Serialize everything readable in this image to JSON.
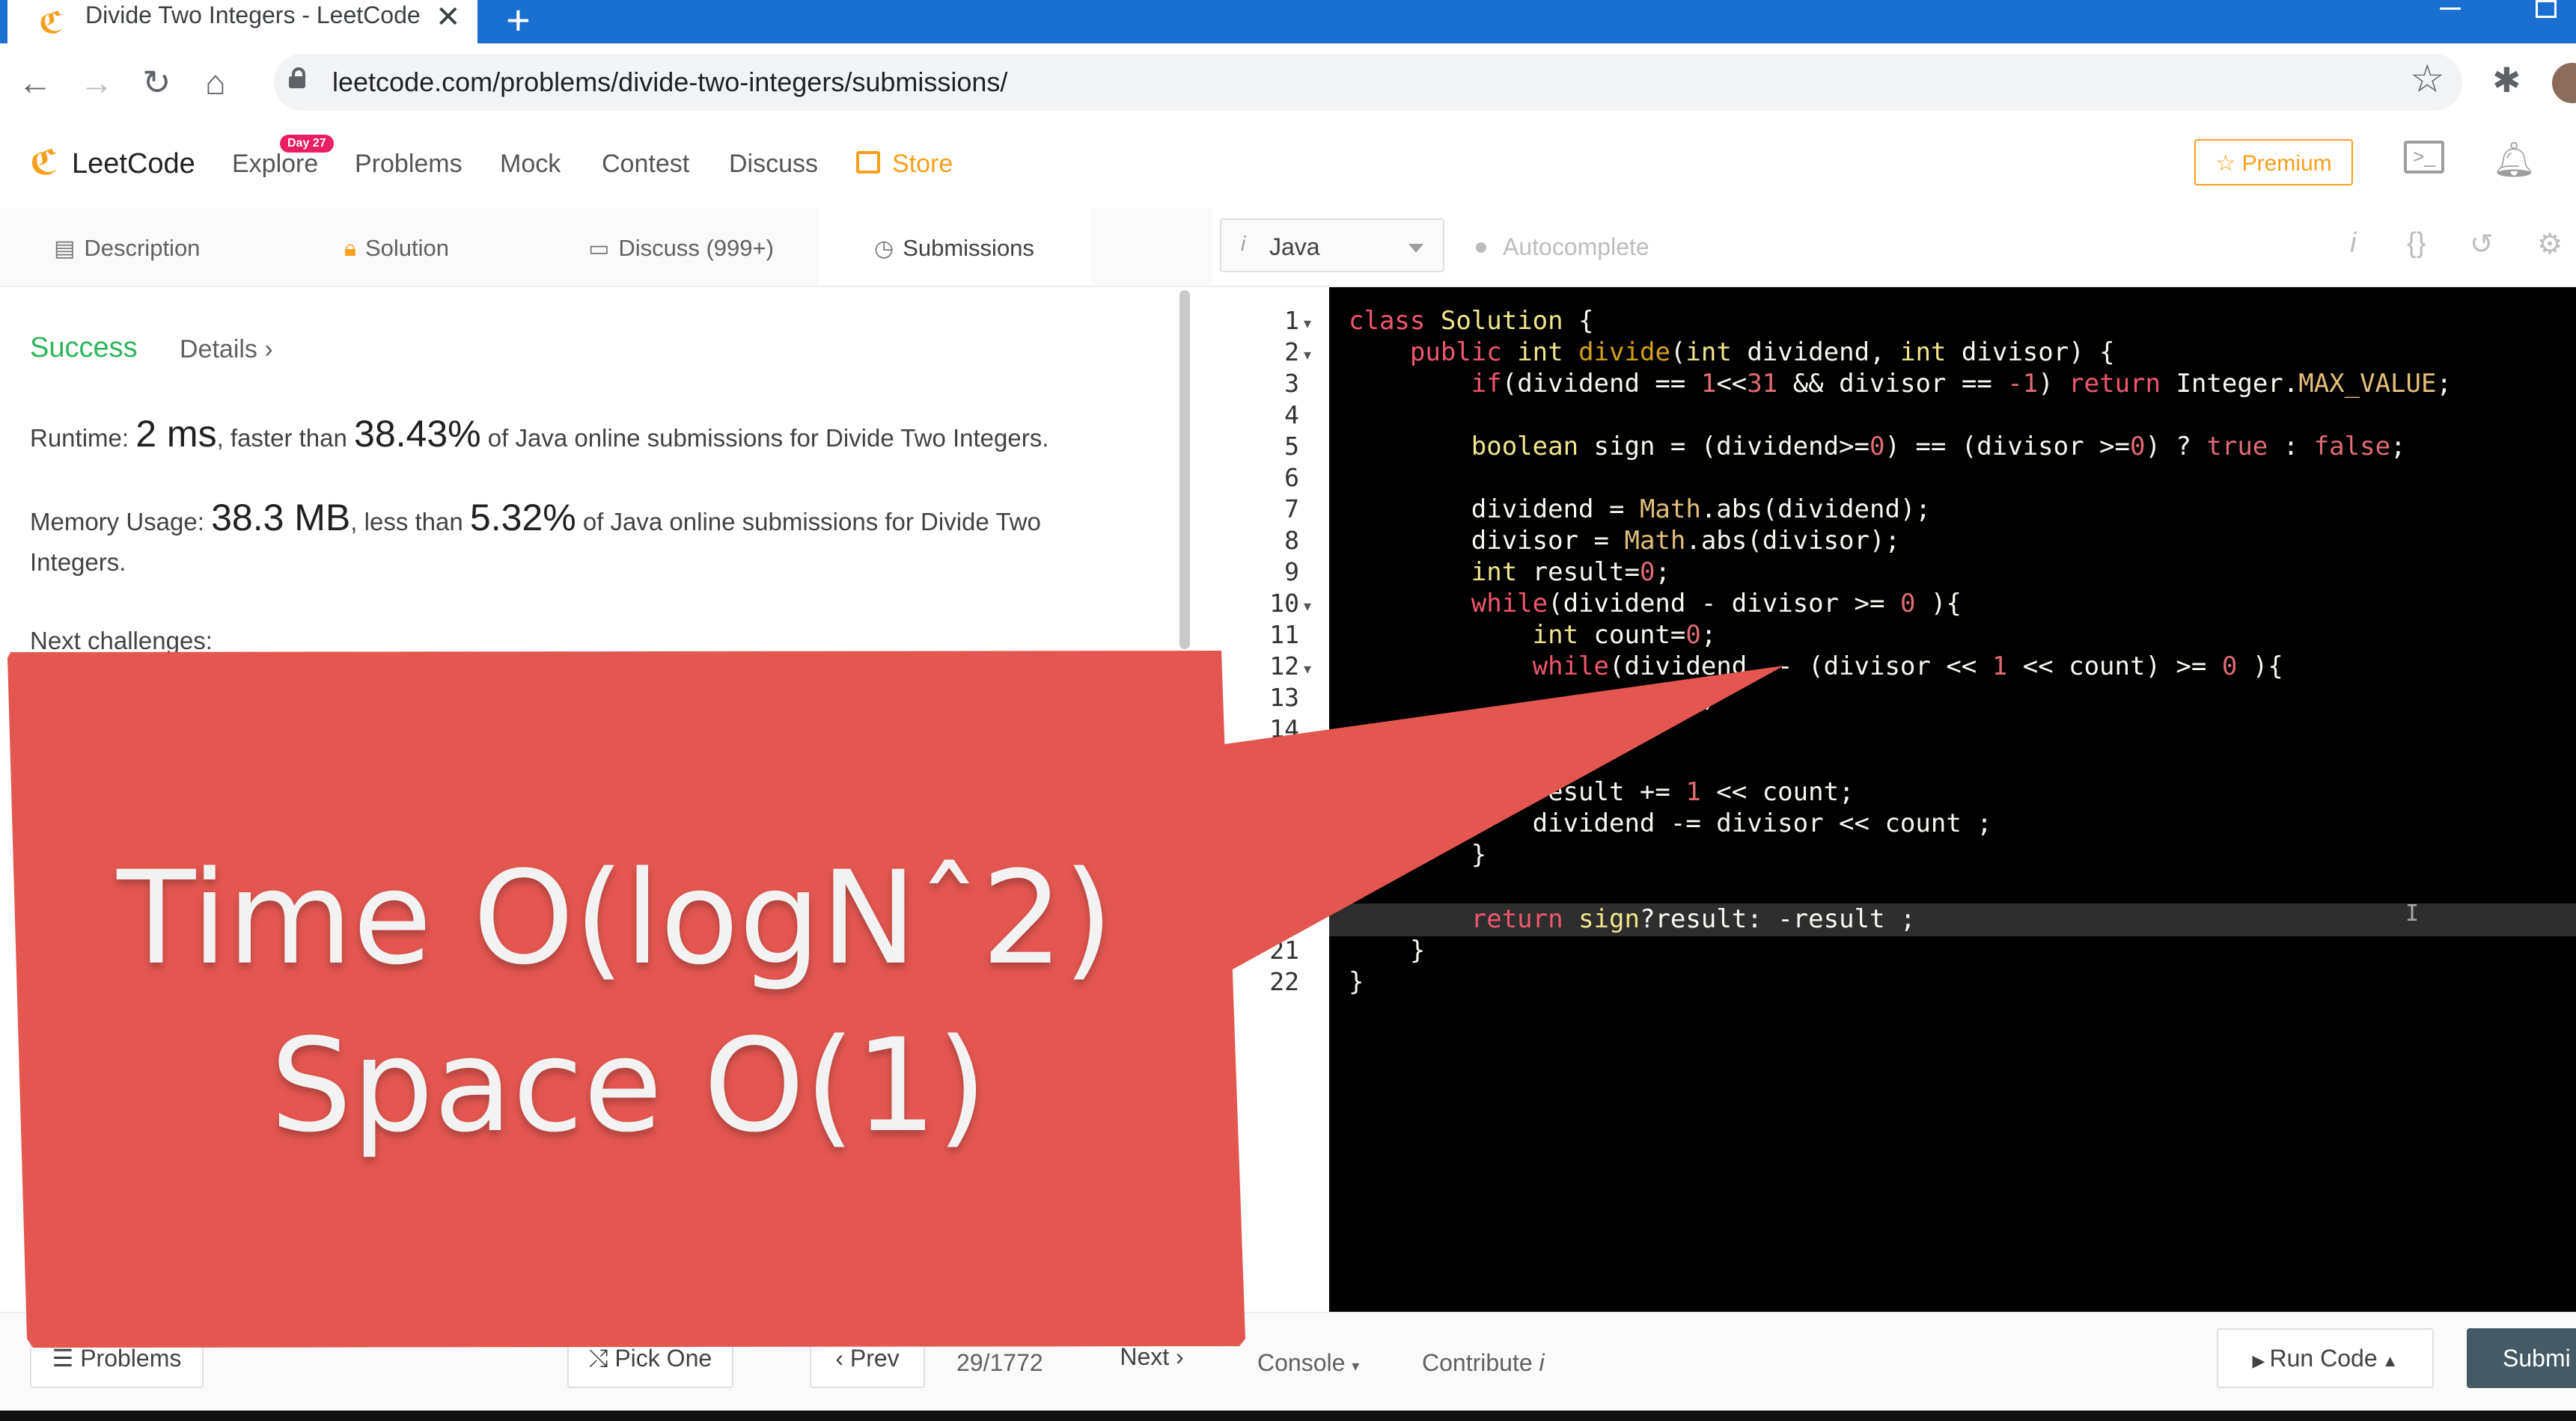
{
  "browser": {
    "tab_title": "Divide Two Integers - LeetCode",
    "tab_close": "✕",
    "new_tab": "+",
    "url": "leetcode.com/problems/divide-two-integers/submissions/",
    "icons": [
      "back-icon",
      "forward-icon",
      "reload-icon",
      "home-icon",
      "lock-icon",
      "star-icon",
      "extensions-icon"
    ]
  },
  "nav": {
    "brand": "LeetCode",
    "links": [
      "Explore",
      "Problems",
      "Mock",
      "Contest",
      "Discuss",
      "Store"
    ],
    "explore_badge": "Day 27",
    "premium": "☆ Premium",
    "accent": "#f89f1b"
  },
  "left_tabs": [
    "Description",
    "Solution",
    "Discuss (999+)",
    "Submissions"
  ],
  "result": {
    "status": "Success",
    "details": "Details ›",
    "runtime_label": "Runtime: ",
    "runtime_value": "2 ms",
    "runtime_mid": ", faster than ",
    "runtime_pct": "38.43%",
    "runtime_tail": " of Java online submissions for Divide Two Integers.",
    "memory_label": "Memory Usage: ",
    "memory_value": "38.3 MB",
    "memory_mid": ", less than ",
    "memory_pct": "5.32%",
    "memory_tail": " of Java online submissions for Divide Two",
    "memory_tail2": "Integers.",
    "next_challenges": "Next challenges:",
    "success_color": "#2db55d"
  },
  "editor": {
    "language": "Java",
    "autocomplete": "Autocomplete",
    "line_numbers": [
      "1",
      "2",
      "3",
      "4",
      "5",
      "6",
      "7",
      "8",
      "9",
      "10",
      "11",
      "12",
      "13",
      "14",
      "20",
      "21",
      "22"
    ]
  },
  "bottom": {
    "problems": "Problems",
    "pick_one": "Pick One",
    "prev": "Prev",
    "page": "29/1772",
    "next": "Next",
    "console": "Console",
    "contribute": "Contribute",
    "run_code": "Run Code",
    "submit": "Submi"
  },
  "overlay": {
    "line1": "Time O(logNˆ2)",
    "line2": "Space O(1)",
    "color": "#e35750"
  }
}
